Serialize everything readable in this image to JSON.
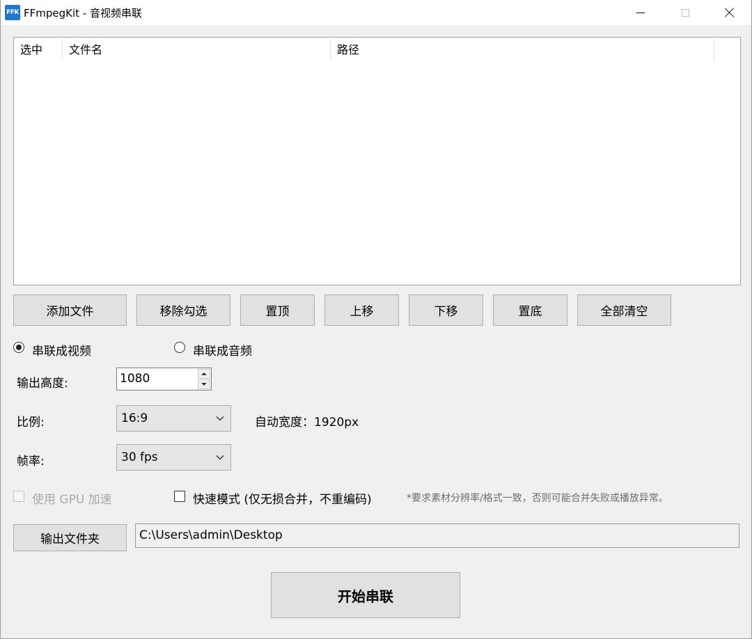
{
  "window": {
    "title": "FFmpegKit - 音视频串联",
    "icon_text": "FFK",
    "icon_color": "#1e78d2"
  },
  "list": {
    "columns": [
      "选中",
      "文件名",
      "路径"
    ],
    "rows": []
  },
  "buttons": {
    "add_file": "添加文件",
    "remove_checked": "移除勾选",
    "to_top": "置顶",
    "move_up": "上移",
    "move_down": "下移",
    "to_bottom": "置底",
    "clear_all": "全部清空",
    "output_folder": "输出文件夹",
    "start": "开始串联"
  },
  "mode": {
    "video_label": "串联成视频",
    "audio_label": "串联成音频",
    "selected": "video"
  },
  "settings": {
    "height_label": "输出高度:",
    "height_value": "1080",
    "ratio_label": "比例:",
    "ratio_value": "16:9",
    "auto_width": "自动宽度：1920px",
    "fps_label": "帧率:",
    "fps_value": "30 fps"
  },
  "options": {
    "gpu_label": "使用 GPU 加速",
    "gpu_enabled": false,
    "fast_label": "快速模式 (仅无损合并，不重编码)",
    "fast_checked": false,
    "note": "*要求素材分辨率/格式一致，否则可能合并失败或播放异常。"
  },
  "output": {
    "path": "C:\\Users\\admin\\Desktop"
  }
}
